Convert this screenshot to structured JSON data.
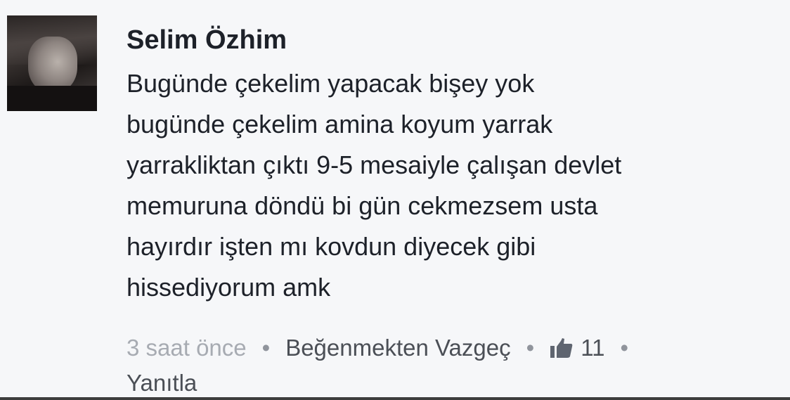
{
  "comment": {
    "author": "Selim Özhim",
    "lines": [
      "Bugünde çekelim yapacak bişey yok",
      "bugünde çekelim amina koyum yarrak",
      "yarrakliktan çıktı 9-5 mesaiyle çalışan devlet",
      "memuruna döndü bi gün cekmezsem usta",
      "hayırdır işten mı kovdun diyecek gibi",
      "hissediyorum amk"
    ],
    "time": "3 saat önce",
    "separator": "•",
    "unlike_label": "Beğenmekten Vazgeç",
    "like_count": "11",
    "reply_label": "Yanıtla",
    "like_icon": "thumbs-up-icon"
  }
}
